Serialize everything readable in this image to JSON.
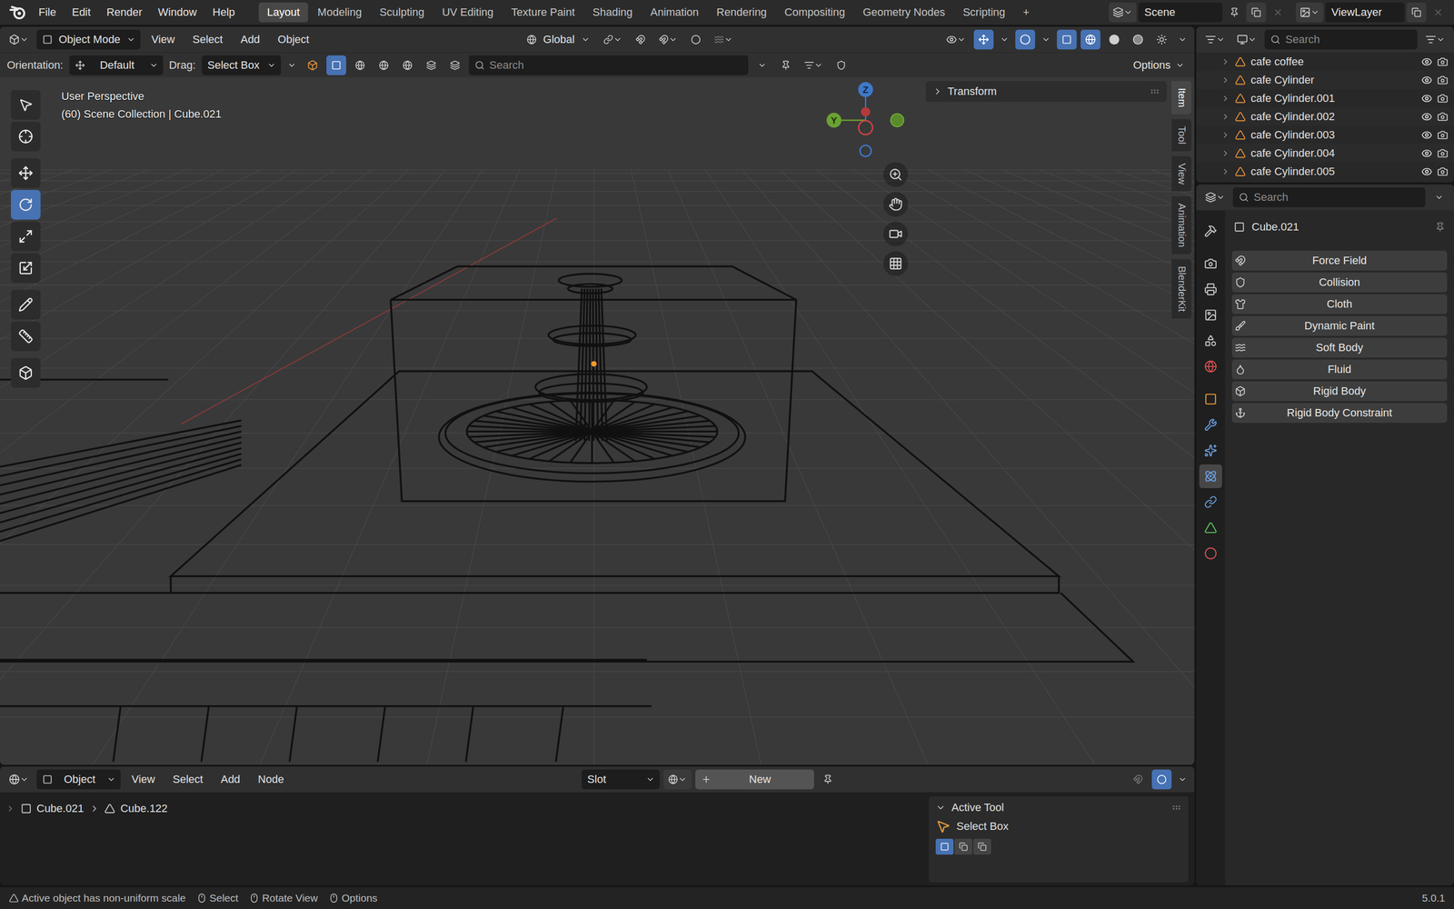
{
  "menubar": {
    "menus": [
      "File",
      "Edit",
      "Render",
      "Window",
      "Help"
    ],
    "workspaces": [
      {
        "label": "Layout",
        "selected": true
      },
      {
        "label": "Modeling",
        "selected": false
      },
      {
        "label": "Sculpting",
        "selected": false
      },
      {
        "label": "UV Editing",
        "selected": false
      },
      {
        "label": "Texture Paint",
        "selected": false
      },
      {
        "label": "Shading",
        "selected": false
      },
      {
        "label": "Animation",
        "selected": false
      },
      {
        "label": "Rendering",
        "selected": false
      },
      {
        "label": "Compositing",
        "selected": false
      },
      {
        "label": "Geometry Nodes",
        "selected": false
      },
      {
        "label": "Scripting",
        "selected": false
      }
    ],
    "add_workspace": "+",
    "scene": "Scene",
    "view_layer": "ViewLayer"
  },
  "viewport_header": {
    "mode": "Object Mode",
    "menus": [
      "View",
      "Select",
      "Add",
      "Object"
    ],
    "transform_orientation": "Global"
  },
  "tool_settings": {
    "orientation_label": "Orientation:",
    "orientation": "Default",
    "drag_label": "Drag:",
    "drag": "Select Box",
    "search_placeholder": "Search",
    "options": "Options"
  },
  "viewport": {
    "view_name": "User Perspective",
    "context": "(60) Scene Collection | Cube.021",
    "gizmo_labels": [
      "Z",
      "Y"
    ],
    "transform_panel": {
      "title": "Transform",
      "expanded": false
    },
    "tools": [
      {
        "kind": "select",
        "selected": false
      },
      {
        "kind": "cursor",
        "selected": false
      },
      {
        "kind": "move",
        "selected": false
      },
      {
        "kind": "rotate",
        "selected": true
      },
      {
        "kind": "scale",
        "selected": false
      },
      {
        "kind": "transform",
        "selected": false
      },
      {
        "kind": "annotate",
        "selected": false
      },
      {
        "kind": "measure",
        "selected": false
      },
      {
        "kind": "add",
        "selected": false
      }
    ],
    "side_tabs": [
      {
        "label": "Item",
        "selected": true
      },
      {
        "label": "Tool",
        "selected": false
      },
      {
        "label": "View",
        "selected": false
      },
      {
        "label": "Animation",
        "selected": false
      },
      {
        "label": "BlenderKit",
        "selected": false
      }
    ]
  },
  "node_editor": {
    "object_type": "Object",
    "menus": [
      "View",
      "Select",
      "Add",
      "Node"
    ],
    "slot": "Slot",
    "new_button": "New",
    "breadcrumb": [
      "Cube.021",
      "Cube.122"
    ],
    "active_tool": {
      "title": "Active Tool",
      "expanded": true,
      "tool": "Select Box"
    }
  },
  "outliner": {
    "search_placeholder": "Search",
    "rows": [
      {
        "name": "cafe coffee",
        "visible": true
      },
      {
        "name": "cafe Cylinder",
        "visible": true
      },
      {
        "name": "cafe Cylinder.001",
        "visible": true
      },
      {
        "name": "cafe Cylinder.002",
        "visible": true
      },
      {
        "name": "cafe Cylinder.003",
        "visible": true
      },
      {
        "name": "cafe Cylinder.004",
        "visible": true
      },
      {
        "name": "cafe Cylinder.005",
        "visible": true
      }
    ]
  },
  "properties": {
    "search_placeholder": "Search",
    "object": "Cube.021",
    "tabs": [
      {
        "kind": "tool",
        "selected": false
      },
      {
        "kind": "render",
        "selected": false
      },
      {
        "kind": "output",
        "selected": false
      },
      {
        "kind": "view_layer",
        "selected": false
      },
      {
        "kind": "scene",
        "selected": false
      },
      {
        "kind": "world",
        "selected": false
      },
      {
        "kind": "object",
        "selected": false
      },
      {
        "kind": "modifiers",
        "selected": false
      },
      {
        "kind": "particles",
        "selected": false
      },
      {
        "kind": "physics",
        "selected": true
      },
      {
        "kind": "constraints",
        "selected": false
      },
      {
        "kind": "data",
        "selected": false
      },
      {
        "kind": "material",
        "selected": false
      }
    ],
    "buttons": [
      "Force Field",
      "Collision",
      "Cloth",
      "Dynamic Paint",
      "Soft Body",
      "Fluid",
      "Rigid Body",
      "Rigid Body Constraint"
    ]
  },
  "status_bar": {
    "message": "Active object has non-uniform scale",
    "hints": [
      "Select",
      "Rotate View",
      "Options"
    ],
    "version": "5.0.1"
  }
}
